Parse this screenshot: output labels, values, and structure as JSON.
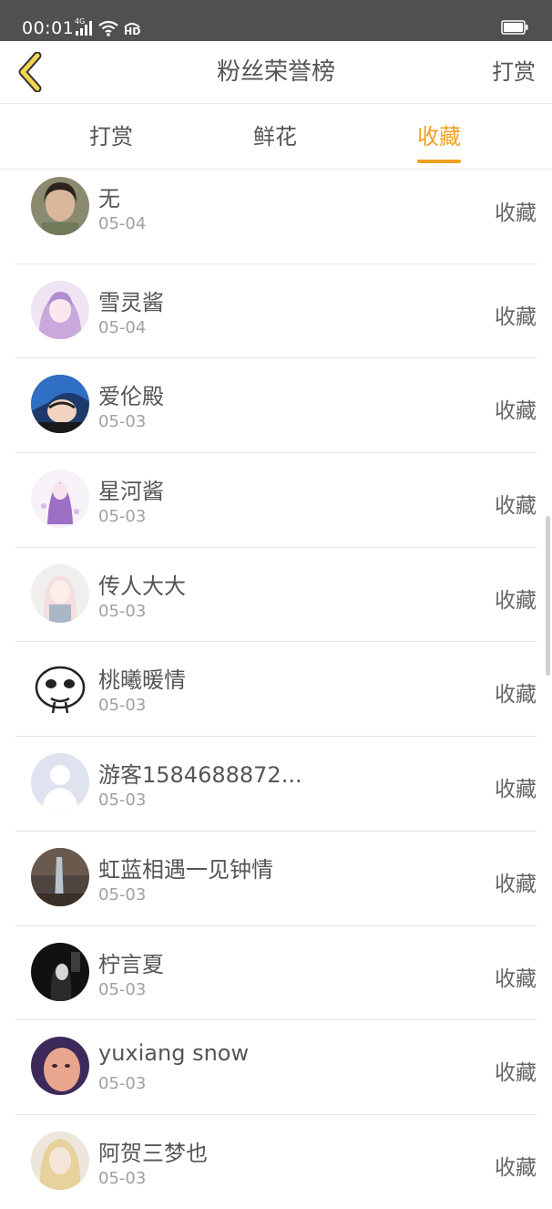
{
  "status_bar": {
    "time": "00:01",
    "network_label": "4G",
    "hd_label": "HD"
  },
  "header": {
    "title": "粉丝荣誉榜",
    "action": "打赏"
  },
  "tabs": [
    {
      "label": "打赏",
      "active": false
    },
    {
      "label": "鲜花",
      "active": false
    },
    {
      "label": "收藏",
      "active": true
    }
  ],
  "accent_color": "#f0a020",
  "list": [
    {
      "name": "无",
      "date": "05-04",
      "action": "收藏",
      "avatar": "photo-girl"
    },
    {
      "name": "雪灵酱",
      "date": "05-04",
      "action": "收藏",
      "avatar": "anime-purple-girl"
    },
    {
      "name": "爱伦殿",
      "date": "05-03",
      "action": "收藏",
      "avatar": "anime-blue-hair"
    },
    {
      "name": "星河酱",
      "date": "05-03",
      "action": "收藏",
      "avatar": "anime-purple-figure"
    },
    {
      "name": "传人大大",
      "date": "05-03",
      "action": "收藏",
      "avatar": "anime-white-girl"
    },
    {
      "name": "桃曦暖情",
      "date": "05-03",
      "action": "收藏",
      "avatar": "meme-face"
    },
    {
      "name": "游客1584688872...",
      "date": "05-03",
      "action": "收藏",
      "avatar": "default-user"
    },
    {
      "name": "虹蓝相遇一见钟情",
      "date": "05-03",
      "action": "收藏",
      "avatar": "dark-scene"
    },
    {
      "name": "柠言夏",
      "date": "05-03",
      "action": "收藏",
      "avatar": "black-white-photo"
    },
    {
      "name": "yuxiang snow",
      "date": "05-03",
      "action": "收藏",
      "avatar": "selfie-face"
    },
    {
      "name": "阿贺三梦也",
      "date": "05-03",
      "action": "收藏",
      "avatar": "anime-blonde"
    }
  ]
}
